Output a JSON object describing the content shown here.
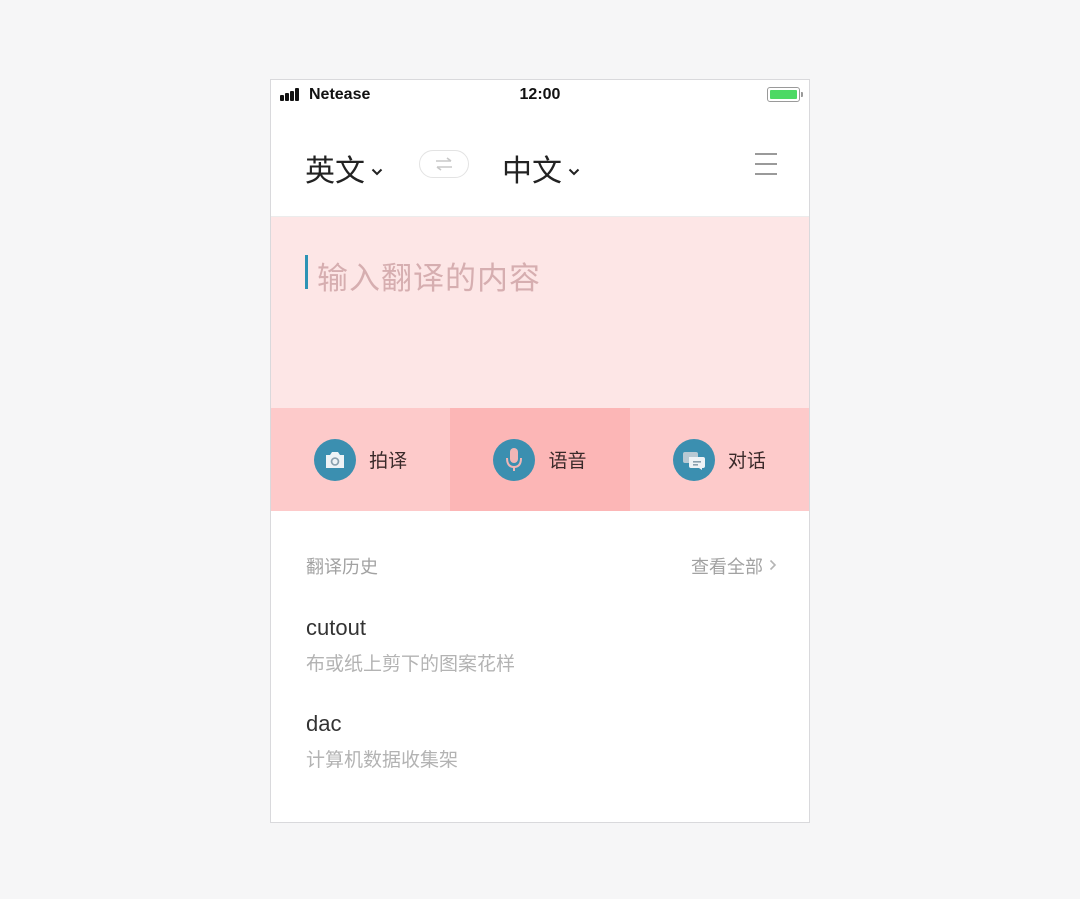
{
  "status_bar": {
    "carrier": "Netease",
    "time": "12:00",
    "battery_color": "#4cd964"
  },
  "header": {
    "source_lang": "英文",
    "target_lang": "中文",
    "swap_icon": "swap-arrows-icon",
    "menu_icon": "hamburger-menu-icon"
  },
  "input": {
    "placeholder": "输入翻译的内容",
    "background": "#fde6e6",
    "caret_color": "#2d93b5"
  },
  "actions": [
    {
      "label": "拍译",
      "icon": "camera-icon",
      "background": "#fdcaca",
      "selected": false
    },
    {
      "label": "语音",
      "icon": "microphone-icon",
      "background": "#fcb6b6",
      "selected": true
    },
    {
      "label": "对话",
      "icon": "chat-bubbles-icon",
      "background": "#fdcaca",
      "selected": false
    }
  ],
  "history": {
    "title": "翻译历史",
    "view_all": "查看全部",
    "items": [
      {
        "word": "cutout",
        "definition": "布或纸上剪下的图案花样"
      },
      {
        "word": "dac",
        "definition": "计算机数据收集架"
      }
    ]
  },
  "colors": {
    "icon_circle": "#3b8fb0",
    "page_background": "#f6f6f7"
  }
}
